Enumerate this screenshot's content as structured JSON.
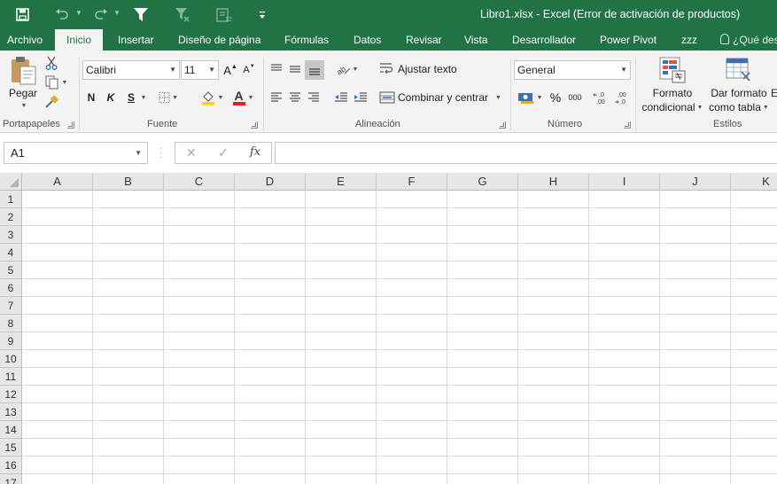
{
  "window": {
    "title": "Libro1.xlsx - Excel (Error de activación de productos)"
  },
  "colors": {
    "brand": "#217346",
    "ribbon_bg": "#f3f3f3",
    "grid_line": "#d9d9d9"
  },
  "quick_access": {
    "save_icon": "save-icon",
    "undo_icon": "undo-icon",
    "redo_icon": "redo-icon",
    "filter_icon": "filter-icon",
    "clear_filter_icon": "clear-filter-icon",
    "form_icon": "form-icon",
    "customize_icon": "customize-qat-icon"
  },
  "tabs": [
    {
      "label": "Archivo"
    },
    {
      "label": "Inicio",
      "active": true
    },
    {
      "label": "Insertar"
    },
    {
      "label": "Diseño de página"
    },
    {
      "label": "Fórmulas"
    },
    {
      "label": "Datos"
    },
    {
      "label": "Revisar"
    },
    {
      "label": "Vista"
    },
    {
      "label": "Desarrollador"
    },
    {
      "label": "Power Pivot"
    },
    {
      "label": "zzz"
    }
  ],
  "tell_me": "¿Qué des",
  "ribbon": {
    "clipboard": {
      "label": "Portapapeles",
      "paste": "Pegar"
    },
    "font": {
      "label": "Fuente",
      "font_name": "Calibri",
      "font_size": "11",
      "bold": "N",
      "italic": "K",
      "underline": "S",
      "grow": "A",
      "shrink": "A",
      "font_color": "A"
    },
    "alignment": {
      "label": "Alineación",
      "wrap_text": "Ajustar texto",
      "merge_center": "Combinar y centrar"
    },
    "number": {
      "label": "Número",
      "format": "General",
      "percent": "%",
      "thousands": "000",
      "inc_decimal": "←,0 ,00",
      "dec_decimal": ",00 →,0"
    },
    "styles": {
      "label": "Estilos",
      "conditional_1": "Formato",
      "conditional_2": "condicional",
      "table_1": "Dar formato",
      "table_2": "como tabla",
      "cell_styles": "E"
    }
  },
  "formula_bar": {
    "name_box": "A1",
    "cancel": "✕",
    "enter": "✓",
    "fx": "fx",
    "value": ""
  },
  "sheet": {
    "columns": [
      "A",
      "B",
      "C",
      "D",
      "E",
      "F",
      "G",
      "H",
      "I",
      "J",
      "K"
    ],
    "rows": [
      "1",
      "2",
      "3",
      "4",
      "5",
      "6",
      "7",
      "8",
      "9",
      "10",
      "11",
      "12",
      "13",
      "14",
      "15",
      "16",
      "17"
    ]
  }
}
